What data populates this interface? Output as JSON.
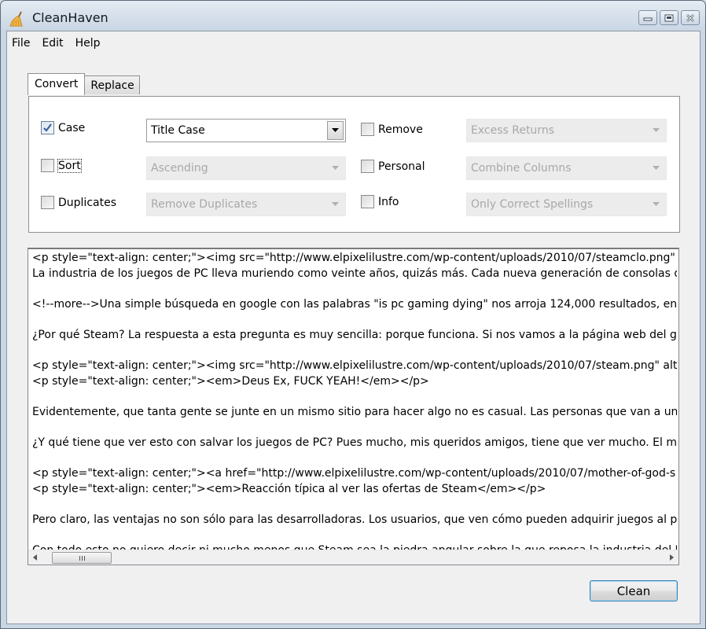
{
  "window": {
    "title": "CleanHaven",
    "icon": "broom-icon",
    "controls": {
      "minimize": "minimize-icon",
      "maximize": "maximize-icon",
      "close": "close-icon"
    }
  },
  "menu": [
    "File",
    "Edit",
    "Help"
  ],
  "tabs": [
    {
      "label": "Convert",
      "active": true
    },
    {
      "label": "Replace",
      "active": false
    }
  ],
  "options": {
    "left": [
      {
        "label": "Case",
        "checked": true,
        "select": "Title Case",
        "enabled": true
      },
      {
        "label": "Sort",
        "checked": false,
        "select": "Ascending",
        "enabled": false,
        "focused": true
      },
      {
        "label": "Duplicates",
        "checked": false,
        "select": "Remove Duplicates",
        "enabled": false
      }
    ],
    "right": [
      {
        "label": "Remove",
        "checked": false,
        "select": "Excess Returns",
        "enabled": false
      },
      {
        "label": "Personal",
        "checked": false,
        "select": "Combine Columns",
        "enabled": false
      },
      {
        "label": "Info",
        "checked": false,
        "select": "Only Correct Spellings",
        "enabled": false
      }
    ]
  },
  "editor": {
    "lines": [
      "<p style=\"text-align: center;\"><img src=\"http://www.elpixelilustre.com/wp-content/uploads/2010/07/steamclo.png\" a",
      "La industria de los juegos de PC lleva muriendo como veinte años, quizás más. Cada nueva generación de consolas que",
      "",
      "<!--more-->Una simple búsqueda en google con las palabras \"is pc gaming dying\" nos arroja 124,000 resultados, entre",
      "",
      "¿Por qué Steam? La respuesta a esta pregunta es muy sencilla: porque funciona. Si nos vamos a la página web del giga",
      "",
      "<p style=\"text-align: center;\"><img src=\"http://www.elpixelilustre.com/wp-content/uploads/2010/07/steam.png\" alt=",
      "<p style=\"text-align: center;\"><em>Deus Ex, FUCK YEAH!</em></p>",
      "",
      "Evidentemente, que tanta gente se junte en un mismo sitio para hacer algo no es casual. Las personas que van a un co",
      "",
      "¿Y qué tiene que ver esto con salvar los juegos de PC? Pues mucho, mis queridos amigos, tiene que ver mucho. El moti",
      "",
      "<p style=\"text-align: center;\"><a href=\"http://www.elpixelilustre.com/wp-content/uploads/2010/07/mother-of-god-s",
      "<p style=\"text-align: center;\"><em>Reacción típica al ver las ofertas de Steam</em></p>",
      "",
      "Pero claro, las ventajas no son sólo para las desarrolladoras. Los usuarios, que ven cómo pueden adquirir juegos al pre",
      "",
      "Con todo esto no quiero decir ni mucho menos que Steam sea la piedra angular sobre la que reposa la industria del PC."
    ]
  },
  "actions": {
    "clean_label": "Clean"
  }
}
